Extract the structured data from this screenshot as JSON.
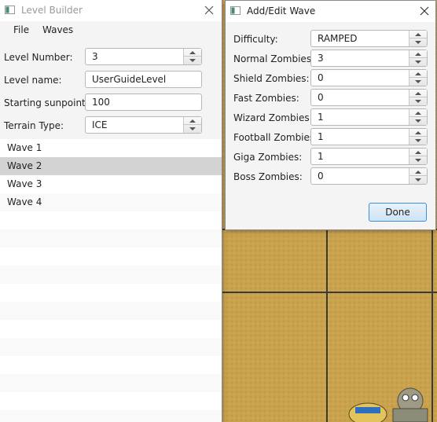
{
  "level_builder": {
    "title": "Level Builder",
    "menu": [
      "File",
      "Waves"
    ],
    "fields": {
      "level_number_label": "Level Number:",
      "level_number": "3",
      "level_name_label": "Level name:",
      "level_name": "UserGuideLevel",
      "sunpoints_label": "Starting sunpoints:",
      "sunpoints": "100",
      "terrain_label": "Terrain Type:",
      "terrain": "ICE"
    },
    "waves": [
      "Wave 1",
      "Wave 2",
      "Wave 3",
      "Wave 4"
    ],
    "selected_wave": "Wave 2"
  },
  "add_edit_wave": {
    "title": "Add/Edit Wave",
    "rows": [
      {
        "label": "Difficulty:",
        "value": "RAMPED"
      },
      {
        "label": "Normal Zombies:",
        "value": "3"
      },
      {
        "label": "Shield Zombies:",
        "value": "0"
      },
      {
        "label": "Fast Zombies:",
        "value": "0"
      },
      {
        "label": "Wizard Zombies:",
        "value": "1"
      },
      {
        "label": "Football Zombies:",
        "value": "1"
      },
      {
        "label": "Giga Zombies:",
        "value": "1"
      },
      {
        "label": "Boss Zombies:",
        "value": "0"
      }
    ],
    "done_label": "Done"
  },
  "colors": {
    "board_sand": "#c9a24e",
    "board_grid": "#3a3a3a",
    "selection": "#d3d3d3",
    "done_border": "#3a8fd6"
  },
  "icons": [
    "window-icon",
    "close-icon",
    "spinner-up-icon",
    "spinner-down-icon",
    "zombie-sprite"
  ]
}
